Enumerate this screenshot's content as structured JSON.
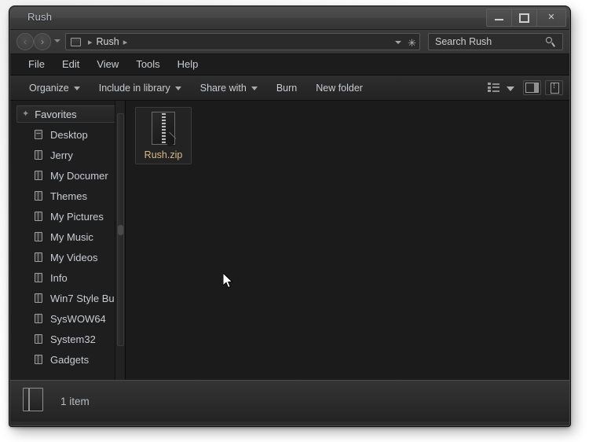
{
  "window": {
    "title": "Rush",
    "controls": {
      "minimize": "minimize-button",
      "maximize": "maximize-button",
      "close": "✕"
    }
  },
  "addressbar": {
    "back_icon": "‹",
    "forward_icon": "›",
    "history_dropdown": "history-dropdown",
    "breadcrumb": [
      "Rush"
    ],
    "separator": "▸",
    "refresh_icon": "✳",
    "folder_icon": "folder-icon"
  },
  "search": {
    "placeholder": "Search Rush",
    "value": "Search Rush",
    "icon": "search-icon"
  },
  "menubar": {
    "items": [
      {
        "label": "File"
      },
      {
        "label": "Edit"
      },
      {
        "label": "View"
      },
      {
        "label": "Tools"
      },
      {
        "label": "Help"
      }
    ]
  },
  "toolbar": {
    "buttons": [
      {
        "label": "Organize",
        "caret": true
      },
      {
        "label": "Include in library",
        "caret": true
      },
      {
        "label": "Share with",
        "caret": true
      },
      {
        "label": "Burn",
        "caret": false
      },
      {
        "label": "New folder",
        "caret": false
      }
    ],
    "view_button": "change-view-button",
    "preview_button": "preview-pane-button",
    "help_button": "help-button"
  },
  "sidebar": {
    "header": {
      "label": "Favorites",
      "icon": "star-icon"
    },
    "items": [
      {
        "label": "Desktop"
      },
      {
        "label": "Jerry"
      },
      {
        "label": "My Documer"
      },
      {
        "label": "Themes"
      },
      {
        "label": "My Pictures"
      },
      {
        "label": "My Music"
      },
      {
        "label": "My Videos"
      },
      {
        "label": "Info"
      },
      {
        "label": "Win7 Style Bu"
      },
      {
        "label": "SysWOW64"
      },
      {
        "label": "System32"
      },
      {
        "label": "Gadgets"
      }
    ]
  },
  "files": [
    {
      "name": "Rush.zip",
      "icon": "zip-file-icon",
      "selected": true
    }
  ],
  "statusbar": {
    "icon": "folder-icon",
    "text": "1 item"
  },
  "colors": {
    "window_bg": "#1b1b1b",
    "titlebar": "#464646",
    "filename": "#d8b98a",
    "text": "#c9ccd1"
  }
}
